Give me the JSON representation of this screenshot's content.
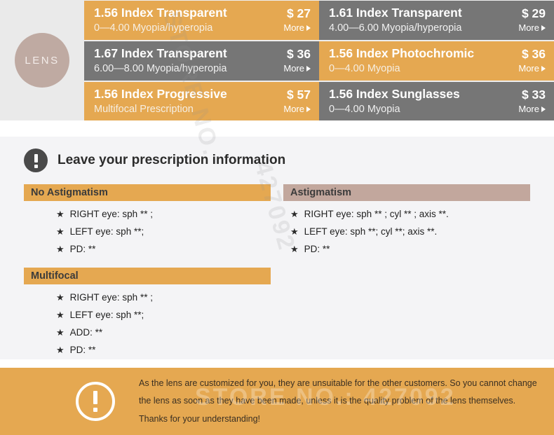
{
  "brand": {
    "circle_label": "LENS"
  },
  "lens_options": [
    {
      "title": "1.56 Index Transparent",
      "subtitle": "0—4.00 Myopia/hyperopia",
      "price": "$ 27",
      "more_label": "More",
      "theme": "orange"
    },
    {
      "title": "1.61 Index Transparent",
      "subtitle": "4.00—6.00 Myopia/hyperopia",
      "price": "$ 29",
      "more_label": "More",
      "theme": "gray"
    },
    {
      "title": "1.67 Index Transparent",
      "subtitle": "6.00—8.00 Myopia/hyperopia",
      "price": "$ 36",
      "more_label": "More",
      "theme": "gray"
    },
    {
      "title": "1.56 Index Photochromic",
      "subtitle": "0—4.00 Myopia",
      "price": "$ 36",
      "more_label": "More",
      "theme": "orange"
    },
    {
      "title": "1.56 Index Progressive",
      "subtitle": "Multifocal Prescription",
      "price": "$ 57",
      "more_label": "More",
      "theme": "orange"
    },
    {
      "title": "1.56 Index Sunglasses",
      "subtitle": "0—4.00 Myopia",
      "price": "$ 33",
      "more_label": "More",
      "theme": "gray"
    }
  ],
  "prescription": {
    "heading": "Leave your prescription information",
    "sections": {
      "no_astigmatism": {
        "label": "No Astigmatism",
        "items": [
          "RIGHT eye:  sph ** ;",
          "LEFT   eye:  sph **;",
          "PD: **"
        ]
      },
      "astigmatism": {
        "label": "Astigmatism",
        "items": [
          "RIGHT eye:  sph ** ; cyl ** ; axis **.",
          "LEFT   eye:  sph **;  cyl **;  axis **.",
          "PD: **"
        ]
      },
      "multifocal": {
        "label": "Multifocal",
        "items": [
          "RIGHT eye:  sph ** ;",
          "LEFT   eye:  sph **;",
          "ADD:  **",
          "PD: **"
        ]
      }
    }
  },
  "notice": {
    "line1": "As the lens are customized for you, they are unsuitable for the other customers. So you cannot  change",
    "line2": "the lens as soon as they have been made, unless it is the quality problem of the lens themselves.",
    "line3": "Thanks for your understanding!"
  },
  "watermarks": {
    "top": "STORE NO.",
    "mid": "427092",
    "bottom": "STORE NO.: 427092"
  },
  "colors": {
    "orange": "#e5a851",
    "gray": "#767676",
    "rose": "#c2a79d",
    "taupe": "#bfaaa2",
    "panel": "#f4f4f6"
  },
  "bullet_glyph": "★"
}
